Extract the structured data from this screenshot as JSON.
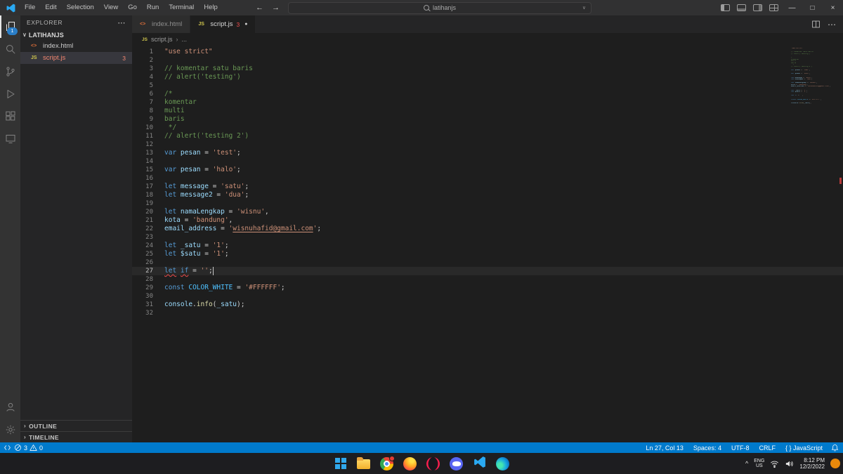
{
  "colors": {
    "statusbar": "#007acc",
    "titlebar": "#313132",
    "activitybar": "#333333",
    "sidebar": "#252526",
    "editor_bg": "#1e1e1e",
    "keyword": "#569cd6",
    "string": "#ce9178",
    "comment": "#6a9955",
    "variable": "#9cdcfe",
    "constant": "#4fc1ff",
    "function": "#dcdcaa",
    "error": "#f14c4c"
  },
  "glyphs": {
    "chevron_down": "∨",
    "chevron_right": "›",
    "ellipsis": "⋯",
    "modified_dot": "●",
    "back_arrow": "←",
    "forward_arrow": "→",
    "minimize": "—",
    "maximize": "□",
    "close": "×",
    "tray_chevron": "^",
    "search_dropdown": "∨"
  },
  "titlebar": {
    "menus": [
      "File",
      "Edit",
      "Selection",
      "View",
      "Go",
      "Run",
      "Terminal",
      "Help"
    ],
    "search_text": "latihanjs"
  },
  "activity_bar": {
    "items": [
      {
        "id": "explorer",
        "icon": "files-icon",
        "active": true,
        "badge": "1"
      },
      {
        "id": "search",
        "icon": "search-icon"
      },
      {
        "id": "source-control",
        "icon": "source-control-icon"
      },
      {
        "id": "run-debug",
        "icon": "run-debug-icon"
      },
      {
        "id": "extensions",
        "icon": "extensions-icon"
      },
      {
        "id": "remote-explorer",
        "icon": "remote-explorer-icon"
      }
    ],
    "bottom": [
      {
        "id": "accounts",
        "icon": "account-icon"
      },
      {
        "id": "settings",
        "icon": "settings-gear-icon"
      }
    ]
  },
  "sidebar": {
    "title": "EXPLORER",
    "folder": "LATIHANJS",
    "files": [
      {
        "id": "index-html",
        "name": "index.html",
        "icon_text": "<>",
        "icon_name": "html-icon",
        "icon_class": "html"
      },
      {
        "id": "script-js",
        "name": "script.js",
        "icon_text": "JS",
        "icon_name": "js-icon",
        "icon_class": "js",
        "badge": "3",
        "selected": true,
        "error": true
      }
    ],
    "sections": [
      {
        "label": "OUTLINE"
      },
      {
        "label": "TIMELINE"
      }
    ]
  },
  "editor": {
    "tabs": [
      {
        "id": "index-html",
        "label": "index.html",
        "icon_text": "<>",
        "icon_class": "html",
        "icon_name": "html-icon"
      },
      {
        "id": "script-js",
        "label": "script.js",
        "icon_text": "JS",
        "icon_class": "js",
        "icon_name": "js-icon",
        "badge": "3",
        "modified": true,
        "active": true
      }
    ],
    "breadcrumb": {
      "icon_text": "JS",
      "file": "script.js",
      "more": "..."
    }
  },
  "code": {
    "cursor": {
      "line": 27,
      "col": 13
    },
    "lines": [
      {
        "n": 1,
        "tokens": [
          {
            "t": "\"use strict\"",
            "c": "s"
          }
        ]
      },
      {
        "n": 2,
        "tokens": []
      },
      {
        "n": 3,
        "tokens": [
          {
            "t": "// komentar satu baris",
            "c": "c"
          }
        ]
      },
      {
        "n": 4,
        "tokens": [
          {
            "t": "// alert('testing')",
            "c": "c"
          }
        ]
      },
      {
        "n": 5,
        "tokens": []
      },
      {
        "n": 6,
        "tokens": [
          {
            "t": "/*",
            "c": "c"
          }
        ]
      },
      {
        "n": 7,
        "tokens": [
          {
            "t": "komentar",
            "c": "c"
          }
        ]
      },
      {
        "n": 8,
        "tokens": [
          {
            "t": "multi",
            "c": "c"
          }
        ]
      },
      {
        "n": 9,
        "tokens": [
          {
            "t": "baris",
            "c": "c"
          }
        ]
      },
      {
        "n": 10,
        "tokens": [
          {
            "t": " */",
            "c": "c"
          }
        ]
      },
      {
        "n": 11,
        "tokens": [
          {
            "t": "// alert('testing 2')",
            "c": "c"
          }
        ]
      },
      {
        "n": 12,
        "tokens": []
      },
      {
        "n": 13,
        "tokens": [
          {
            "t": "var",
            "c": "k"
          },
          {
            "t": " ",
            "c": "p"
          },
          {
            "t": "pesan",
            "c": "v"
          },
          {
            "t": " = ",
            "c": "p"
          },
          {
            "t": "'test'",
            "c": "s"
          },
          {
            "t": ";",
            "c": "p"
          }
        ]
      },
      {
        "n": 14,
        "tokens": []
      },
      {
        "n": 15,
        "tokens": [
          {
            "t": "var",
            "c": "k"
          },
          {
            "t": " ",
            "c": "p"
          },
          {
            "t": "pesan",
            "c": "v"
          },
          {
            "t": " = ",
            "c": "p"
          },
          {
            "t": "'halo'",
            "c": "s"
          },
          {
            "t": ";",
            "c": "p"
          }
        ]
      },
      {
        "n": 16,
        "tokens": []
      },
      {
        "n": 17,
        "tokens": [
          {
            "t": "let",
            "c": "k"
          },
          {
            "t": " ",
            "c": "p"
          },
          {
            "t": "message",
            "c": "v"
          },
          {
            "t": " = ",
            "c": "p"
          },
          {
            "t": "'satu'",
            "c": "s"
          },
          {
            "t": ";",
            "c": "p"
          }
        ]
      },
      {
        "n": 18,
        "tokens": [
          {
            "t": "let",
            "c": "k"
          },
          {
            "t": " ",
            "c": "p"
          },
          {
            "t": "message2",
            "c": "v"
          },
          {
            "t": " = ",
            "c": "p"
          },
          {
            "t": "'dua'",
            "c": "s"
          },
          {
            "t": ";",
            "c": "p"
          }
        ]
      },
      {
        "n": 19,
        "tokens": []
      },
      {
        "n": 20,
        "tokens": [
          {
            "t": "let",
            "c": "k"
          },
          {
            "t": " ",
            "c": "p"
          },
          {
            "t": "namaLengkap",
            "c": "v"
          },
          {
            "t": " = ",
            "c": "p"
          },
          {
            "t": "'wisnu'",
            "c": "s"
          },
          {
            "t": ",",
            "c": "p"
          }
        ]
      },
      {
        "n": 21,
        "tokens": [
          {
            "t": "kota",
            "c": "v"
          },
          {
            "t": " = ",
            "c": "p"
          },
          {
            "t": "'bandung'",
            "c": "s"
          },
          {
            "t": ",",
            "c": "p"
          }
        ]
      },
      {
        "n": 22,
        "tokens": [
          {
            "t": "email_address",
            "c": "v"
          },
          {
            "t": " = ",
            "c": "p"
          },
          {
            "t": "'",
            "c": "s"
          },
          {
            "t": "wisnuhafid@gmail.com",
            "c": "s u"
          },
          {
            "t": "'",
            "c": "s"
          },
          {
            "t": ";",
            "c": "p"
          }
        ]
      },
      {
        "n": 23,
        "tokens": []
      },
      {
        "n": 24,
        "tokens": [
          {
            "t": "let",
            "c": "k"
          },
          {
            "t": " ",
            "c": "p"
          },
          {
            "t": "_satu",
            "c": "v"
          },
          {
            "t": " = ",
            "c": "p"
          },
          {
            "t": "'1'",
            "c": "s"
          },
          {
            "t": ";",
            "c": "p"
          }
        ]
      },
      {
        "n": 25,
        "tokens": [
          {
            "t": "let",
            "c": "k"
          },
          {
            "t": " ",
            "c": "p"
          },
          {
            "t": "$satu",
            "c": "v"
          },
          {
            "t": " = ",
            "c": "p"
          },
          {
            "t": "'1'",
            "c": "s"
          },
          {
            "t": ";",
            "c": "p"
          }
        ]
      },
      {
        "n": 26,
        "tokens": []
      },
      {
        "n": 27,
        "current": true,
        "tokens": [
          {
            "t": "let",
            "c": "k e"
          },
          {
            "t": " ",
            "c": "p"
          },
          {
            "t": "if",
            "c": "k e"
          },
          {
            "t": " = ",
            "c": "p"
          },
          {
            "t": "''",
            "c": "s"
          },
          {
            "t": ";",
            "c": "p"
          }
        ]
      },
      {
        "n": 28,
        "tokens": []
      },
      {
        "n": 29,
        "tokens": [
          {
            "t": "const",
            "c": "k"
          },
          {
            "t": " ",
            "c": "p"
          },
          {
            "t": "COLOR_WHITE",
            "c": "cv"
          },
          {
            "t": " = ",
            "c": "p"
          },
          {
            "t": "'#FFFFFF'",
            "c": "s"
          },
          {
            "t": ";",
            "c": "p"
          }
        ]
      },
      {
        "n": 30,
        "tokens": []
      },
      {
        "n": 31,
        "tokens": [
          {
            "t": "console",
            "c": "v"
          },
          {
            "t": ".",
            "c": "p"
          },
          {
            "t": "info",
            "c": "f"
          },
          {
            "t": "(",
            "c": "p"
          },
          {
            "t": "_satu",
            "c": "v"
          },
          {
            "t": ")",
            "c": "p"
          },
          {
            "t": ";",
            "c": "p"
          }
        ]
      },
      {
        "n": 32,
        "tokens": []
      }
    ]
  },
  "status_bar": {
    "errors": "3",
    "warnings": "0",
    "right": [
      {
        "name": "cursor-position",
        "label": "Ln 27, Col 13"
      },
      {
        "name": "indentation",
        "label": "Spaces: 4"
      },
      {
        "name": "encoding",
        "label": "UTF-8"
      },
      {
        "name": "eol",
        "label": "CRLF"
      },
      {
        "name": "language-mode",
        "label": "{ } JavaScript"
      }
    ]
  },
  "taskbar": {
    "apps": [
      {
        "id": "start"
      },
      {
        "id": "file-explorer"
      },
      {
        "id": "chrome",
        "badge": true
      },
      {
        "id": "firefox"
      },
      {
        "id": "opera-gx"
      },
      {
        "id": "discord"
      },
      {
        "id": "vscode"
      },
      {
        "id": "edge"
      }
    ],
    "tray": {
      "lang_top": "ENG",
      "lang_bottom": "US",
      "time": "8:12 PM",
      "date": "12/2/2022"
    }
  }
}
